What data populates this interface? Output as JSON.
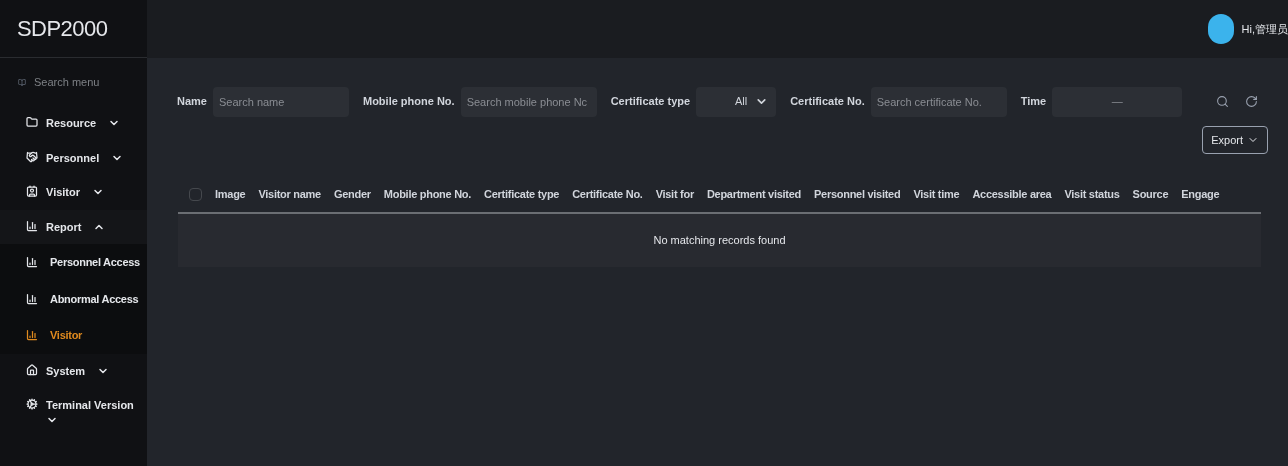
{
  "logo": "SDP2000",
  "user": {
    "greeting": "Hi,管理员"
  },
  "sidebar": {
    "search": {
      "placeholder": "Search menu"
    },
    "items": [
      {
        "label": "Resource",
        "expanded": false
      },
      {
        "label": "Personnel",
        "expanded": false
      },
      {
        "label": "Visitor",
        "expanded": false
      },
      {
        "label": "Report",
        "expanded": true,
        "children": [
          {
            "label": "Personnel Access",
            "selected": false
          },
          {
            "label": "Abnormal Access",
            "selected": false
          },
          {
            "label": "Visitor",
            "selected": true
          }
        ]
      },
      {
        "label": "System",
        "expanded": false
      },
      {
        "label": "Terminal Version",
        "expanded": false
      }
    ]
  },
  "filters": [
    {
      "kind": "text",
      "label": "Name",
      "placeholder": "Search name"
    },
    {
      "kind": "text",
      "label": "Mobile phone No.",
      "placeholder": "Search mobile phone Nc"
    },
    {
      "kind": "select",
      "label": "Certificate type",
      "value": "All"
    },
    {
      "kind": "text",
      "label": "Certificate No.",
      "placeholder": "Search certificate No."
    },
    {
      "kind": "range",
      "label": "Time",
      "value": "—"
    }
  ],
  "export_button": "Export",
  "table": {
    "select_all": {
      "checked": false
    },
    "columns": [
      "Image",
      "Visitor name",
      "Gender",
      "Mobile phone No.",
      "Certificate type",
      "Certificate No.",
      "Visit for",
      "Department visited",
      "Personnel visited",
      "Visit time",
      "Accessible area",
      "Visit status",
      "Source",
      "Engage"
    ],
    "empty_message": "No matching records found"
  }
}
